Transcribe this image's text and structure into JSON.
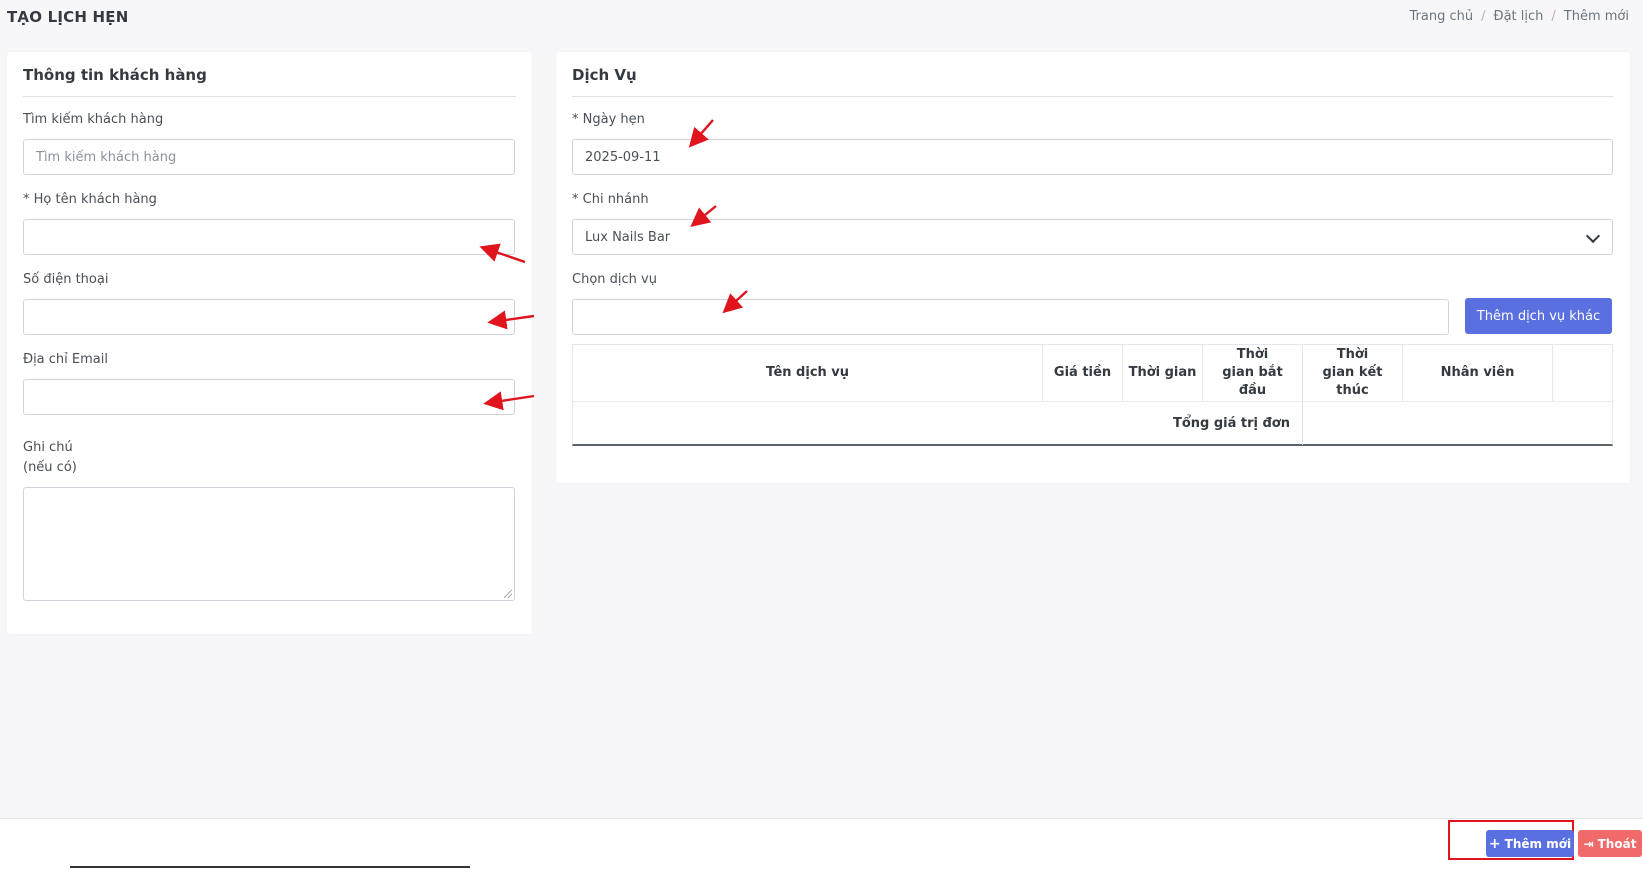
{
  "header": {
    "title": "TẠO LỊCH HẸN",
    "breadcrumb": [
      "Trang chủ",
      "Đặt lịch",
      "Thêm mới"
    ]
  },
  "customer_card": {
    "title": "Thông tin khách hàng",
    "search": {
      "label": "Tìm kiếm khách hàng",
      "placeholder": "Tìm kiếm khách hàng",
      "value": ""
    },
    "name": {
      "label": "* Họ tên khách hàng",
      "value": ""
    },
    "phone": {
      "label": "Số điện thoại",
      "value": ""
    },
    "email": {
      "label": "Địa chỉ Email",
      "value": ""
    },
    "note": {
      "label_line1": "Ghi chú",
      "label_line2": "(nếu có)",
      "value": ""
    }
  },
  "service_card": {
    "title": "Dịch Vụ",
    "date": {
      "label": "* Ngày hẹn",
      "value": "2025-09-11"
    },
    "branch": {
      "label": "* Chi nhánh",
      "value": "Lux Nails Bar"
    },
    "service_select": {
      "label": "Chọn dịch vụ",
      "value": ""
    },
    "add_service_label": "Thêm dịch vụ khác",
    "table": {
      "columns": [
        "Tên dịch vụ",
        "Giá tiền",
        "Thời gian",
        "Thời gian bắt đầu",
        "Thời gian kết thúc",
        "Nhân viên",
        ""
      ],
      "total_label": "Tổng giá trị đơn"
    }
  },
  "footer": {
    "save_label": "Thêm mới",
    "exit_label": "Thoát"
  },
  "colors": {
    "primary": "#5a6fe0",
    "danger": "#f06a6a",
    "annotation_red": "#e0141d"
  },
  "icons": {
    "plus": "plus-icon",
    "exit": "sign-out-icon",
    "chevron": "chevron-down-icon"
  }
}
